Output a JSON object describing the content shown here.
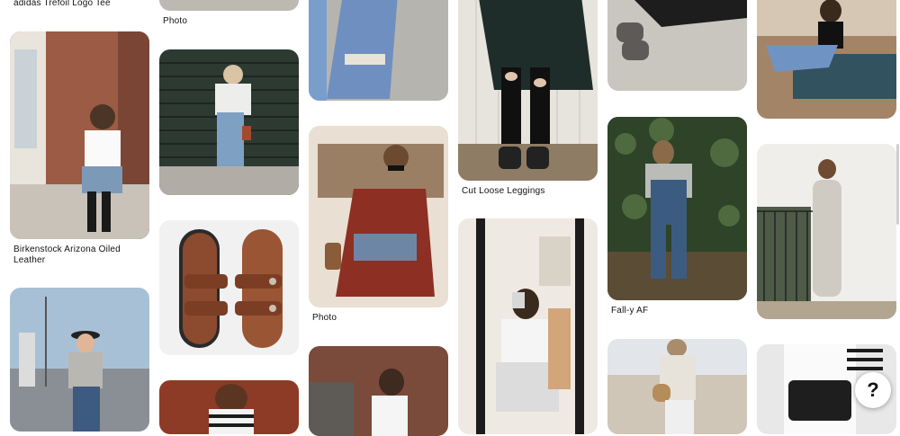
{
  "pins": [
    {
      "id": "col1-top",
      "caption": "adidas Trefoil Logo Tee"
    },
    {
      "id": "col1-pin1",
      "caption": "Birkenstock Arizona Oiled Leather"
    },
    {
      "id": "col1-pin2",
      "caption": ""
    },
    {
      "id": "col2-top",
      "caption": "Photo"
    },
    {
      "id": "col2-pin1",
      "caption": ""
    },
    {
      "id": "col2-pin2",
      "caption": ""
    },
    {
      "id": "col2-pin3",
      "caption": ""
    },
    {
      "id": "col3-pin1",
      "caption": ""
    },
    {
      "id": "col3-pin2",
      "caption": "Photo"
    },
    {
      "id": "col3-pin3",
      "caption": ""
    },
    {
      "id": "col4-pin1",
      "caption": "Cut Loose Leggings"
    },
    {
      "id": "col4-pin2",
      "caption": ""
    },
    {
      "id": "col5-pin1",
      "caption": ""
    },
    {
      "id": "col5-pin2",
      "caption": "Fall-y AF"
    },
    {
      "id": "col5-pin3",
      "caption": ""
    },
    {
      "id": "col6-pin1",
      "caption": ""
    },
    {
      "id": "col6-pin2",
      "caption": ""
    },
    {
      "id": "col6-pin3",
      "caption": ""
    }
  ],
  "help_button": {
    "label": "?"
  }
}
